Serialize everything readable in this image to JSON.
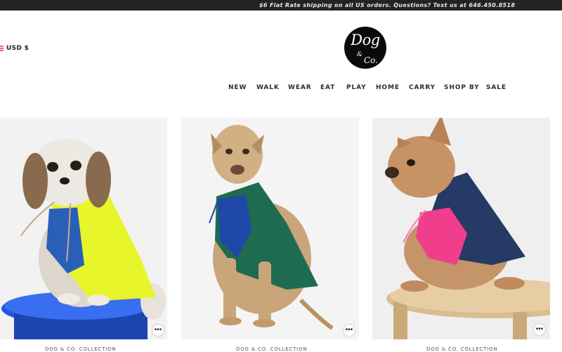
{
  "announcement": "$6 Flat Rate shipping on all US orders. Questions? Text us at 646.450.8518",
  "currency": {
    "label": "USD $",
    "flag_icon": "us-flag-icon"
  },
  "logo": {
    "main": "Dog",
    "amp": "&",
    "co": "Co."
  },
  "nav": {
    "items": [
      {
        "label": "NEW"
      },
      {
        "label": "WALK"
      },
      {
        "label": "WEAR"
      },
      {
        "label": "EAT"
      },
      {
        "label": "PLAY"
      },
      {
        "label": "HOME"
      },
      {
        "label": "CARRY"
      },
      {
        "label": "SHOP BY"
      },
      {
        "label": "SALE"
      }
    ]
  },
  "products": [
    {
      "collection": "DOG & CO. COLLECTION",
      "coat_color": "#e8f52a",
      "lining_color": "#2a5fb8",
      "more_icon": "ellipsis-icon"
    },
    {
      "collection": "DOG & CO. COLLECTION",
      "coat_color": "#1f6b4f",
      "lining_color": "#1f48a8",
      "more_icon": "ellipsis-icon"
    },
    {
      "collection": "DOG & CO. COLLECTION",
      "coat_color": "#263a66",
      "lining_color": "#f03d8c",
      "more_icon": "ellipsis-icon"
    }
  ]
}
